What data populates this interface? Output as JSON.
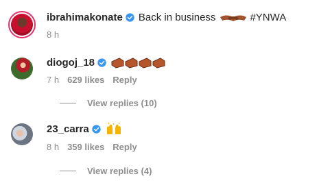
{
  "post": {
    "username": "ibrahimakonate",
    "comment": "Back in business",
    "hashtag": "#YNWA",
    "time": "8 h",
    "emoji": "handshake-icon"
  },
  "comments": [
    {
      "username": "diogoj_18",
      "emoji": "bricks-icon",
      "time": "7 h",
      "likes": "629 likes",
      "reply_label": "Reply",
      "view_replies": "View replies (10)"
    },
    {
      "username": "23_carra",
      "emoji": "raised-hands-icon",
      "time": "8 h",
      "likes": "359 likes",
      "reply_label": "Reply",
      "view_replies": "View replies (4)"
    }
  ],
  "colors": {
    "verified": "#3897f0",
    "meta": "#8e8e8e",
    "text": "#262626",
    "story_ring": "#e1306c"
  }
}
